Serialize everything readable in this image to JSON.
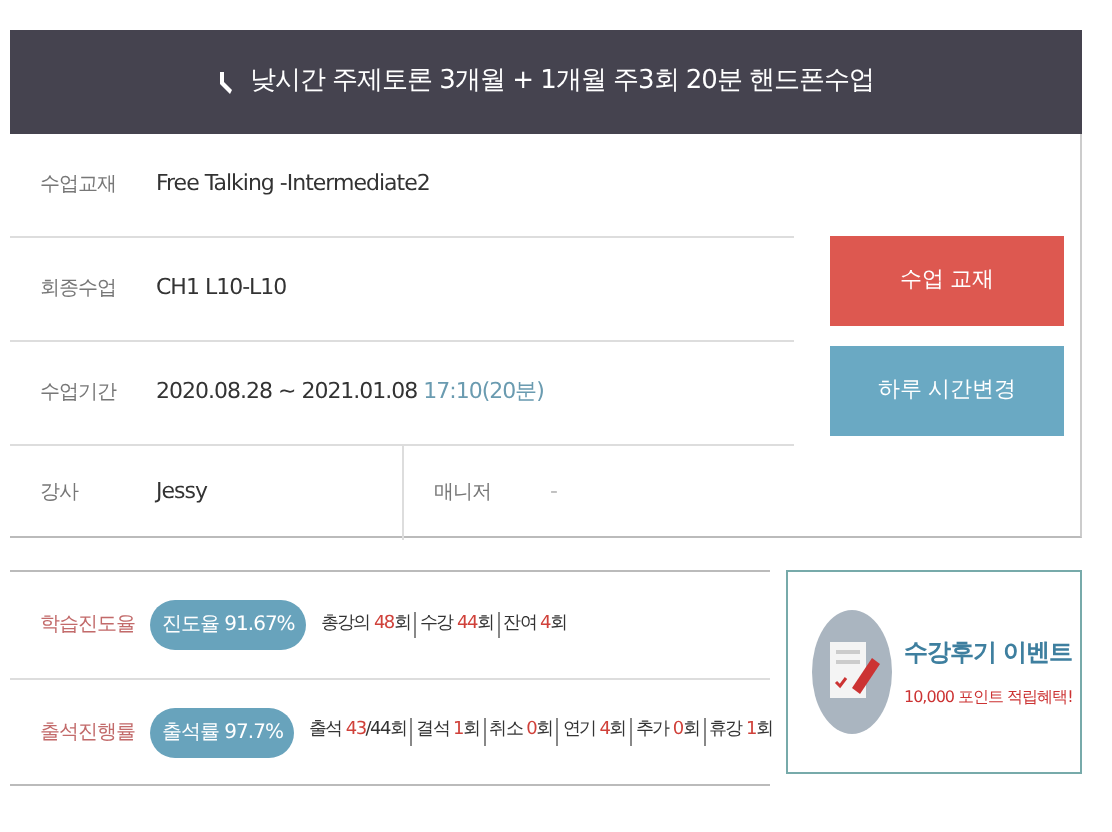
{
  "course": {
    "title": "낮시간 주제토론 3개월 + 1개월 주3회 20분 핸드폰수업"
  },
  "info": [
    {
      "kind": "text",
      "label": "수업교재",
      "value": "Free Talking -Intermediate2"
    },
    {
      "kind": "text",
      "label": "회종수업",
      "value": "CH1 L10-L10"
    },
    {
      "kind": "period",
      "label": "수업기간",
      "value": "2020.08.28 ~ 2021.01.08",
      "time": "17:10(20분)"
    }
  ],
  "teacher": {
    "label": "강사",
    "value": "Jessy"
  },
  "manager": {
    "label": "매니저",
    "value": "-"
  },
  "buttons": [
    {
      "label": "수업 교재",
      "color": "#dd5850"
    },
    {
      "label": "하루 시간변경",
      "color": "#6aa9c3"
    }
  ],
  "stats": [
    {
      "label": "학습진도율",
      "pill": "진도율 91.67%",
      "items": [
        {
          "label": "총강의",
          "count": "48",
          "unit": "회"
        },
        {
          "label": "수강",
          "count": "44",
          "unit": "회"
        },
        {
          "label": "잔여",
          "count": "4",
          "unit": "회"
        }
      ]
    },
    {
      "label": "출석진행률",
      "pill": "출석률 97.7%",
      "items": [
        {
          "label": "출석",
          "count": "43",
          "unit": "/44회"
        },
        {
          "label": "결석",
          "count": "1",
          "unit": "회"
        },
        {
          "label": "취소",
          "count": "0",
          "unit": "회"
        },
        {
          "label": "연기",
          "count": "4",
          "unit": "회"
        },
        {
          "label": "추가",
          "count": "0",
          "unit": "회"
        },
        {
          "label": "휴강",
          "count": "1",
          "unit": "회"
        }
      ]
    }
  ],
  "event": {
    "title": "수강후기 이벤트",
    "subtitle": "10,000 포인트 적립혜택!"
  }
}
